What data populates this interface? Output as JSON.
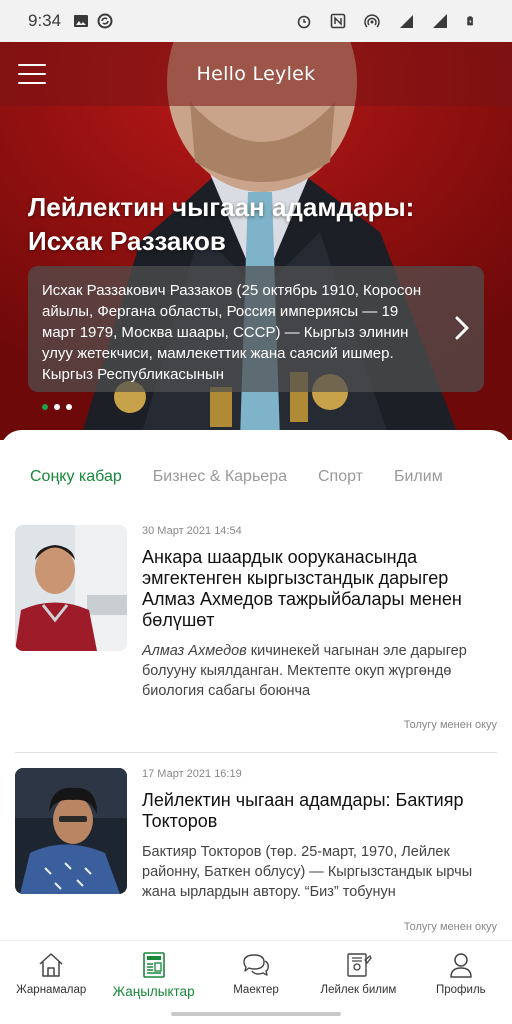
{
  "status_bar": {
    "time": "9:34",
    "network": "4G"
  },
  "header": {
    "app_title": "Hello Leylek"
  },
  "hero": {
    "title": "Лейлектин чыгаан адамдары: Исхак Раззаков",
    "excerpt": "Исхак Раззакович Раззаков (25 октябрь 1910, Коросон айылы, Фергана областы, Россия империясы — 19 март 1979, Москва шаары, СССР) — Кыргыз элинин улуу жетекчиси, мамлекеттик жана саясий ишмер. Кыргыз Республикасынын",
    "dots": 3,
    "active_dot": 0
  },
  "tabs": [
    {
      "label": "Соңку кабар",
      "active": true
    },
    {
      "label": "Бизнес & Карьера",
      "active": false
    },
    {
      "label": "Спорт",
      "active": false
    },
    {
      "label": "Билим",
      "active": false
    }
  ],
  "articles": [
    {
      "date": "30 Март 2021 14:54",
      "title": "Анкара шаардык ооруканасында эмгектенген кыргызстандык дарыгер Алмаз Ахмедов тажрыйбалары менен бөлүшөт",
      "excerpt_emphasis": "Алмаз Ахмедов",
      "excerpt": " кичинекей чагынан эле дарыгер болууну кыялданган. Мектепте окуп жүргөндө биология сабагы боюнча",
      "read_more": "Толугу менен окуу"
    },
    {
      "date": "17 Март 2021 16:19",
      "title": "Лейлектин чыгаан адамдары: Бактияр Токторов",
      "excerpt": "Бактияр Токторов (төр. 25-март, 1970, Лейлек районну, Баткен облусу) — Кыргызстандык ырчы жана ырлардын автору. “Биз” тобунун",
      "read_more": "Толугу менен окуу"
    }
  ],
  "bottom_nav": [
    {
      "label": "Жарнамалар",
      "icon": "home-icon",
      "active": false
    },
    {
      "label": "Жаңылыктар",
      "icon": "news-icon",
      "active": true
    },
    {
      "label": "Маектер",
      "icon": "chat-icon",
      "active": false
    },
    {
      "label": "Лейлек билим",
      "icon": "education-icon",
      "active": false
    },
    {
      "label": "Профиль",
      "icon": "profile-icon",
      "active": false
    }
  ],
  "colors": {
    "accent": "#17893a",
    "hero_bg": "#8b1010"
  }
}
